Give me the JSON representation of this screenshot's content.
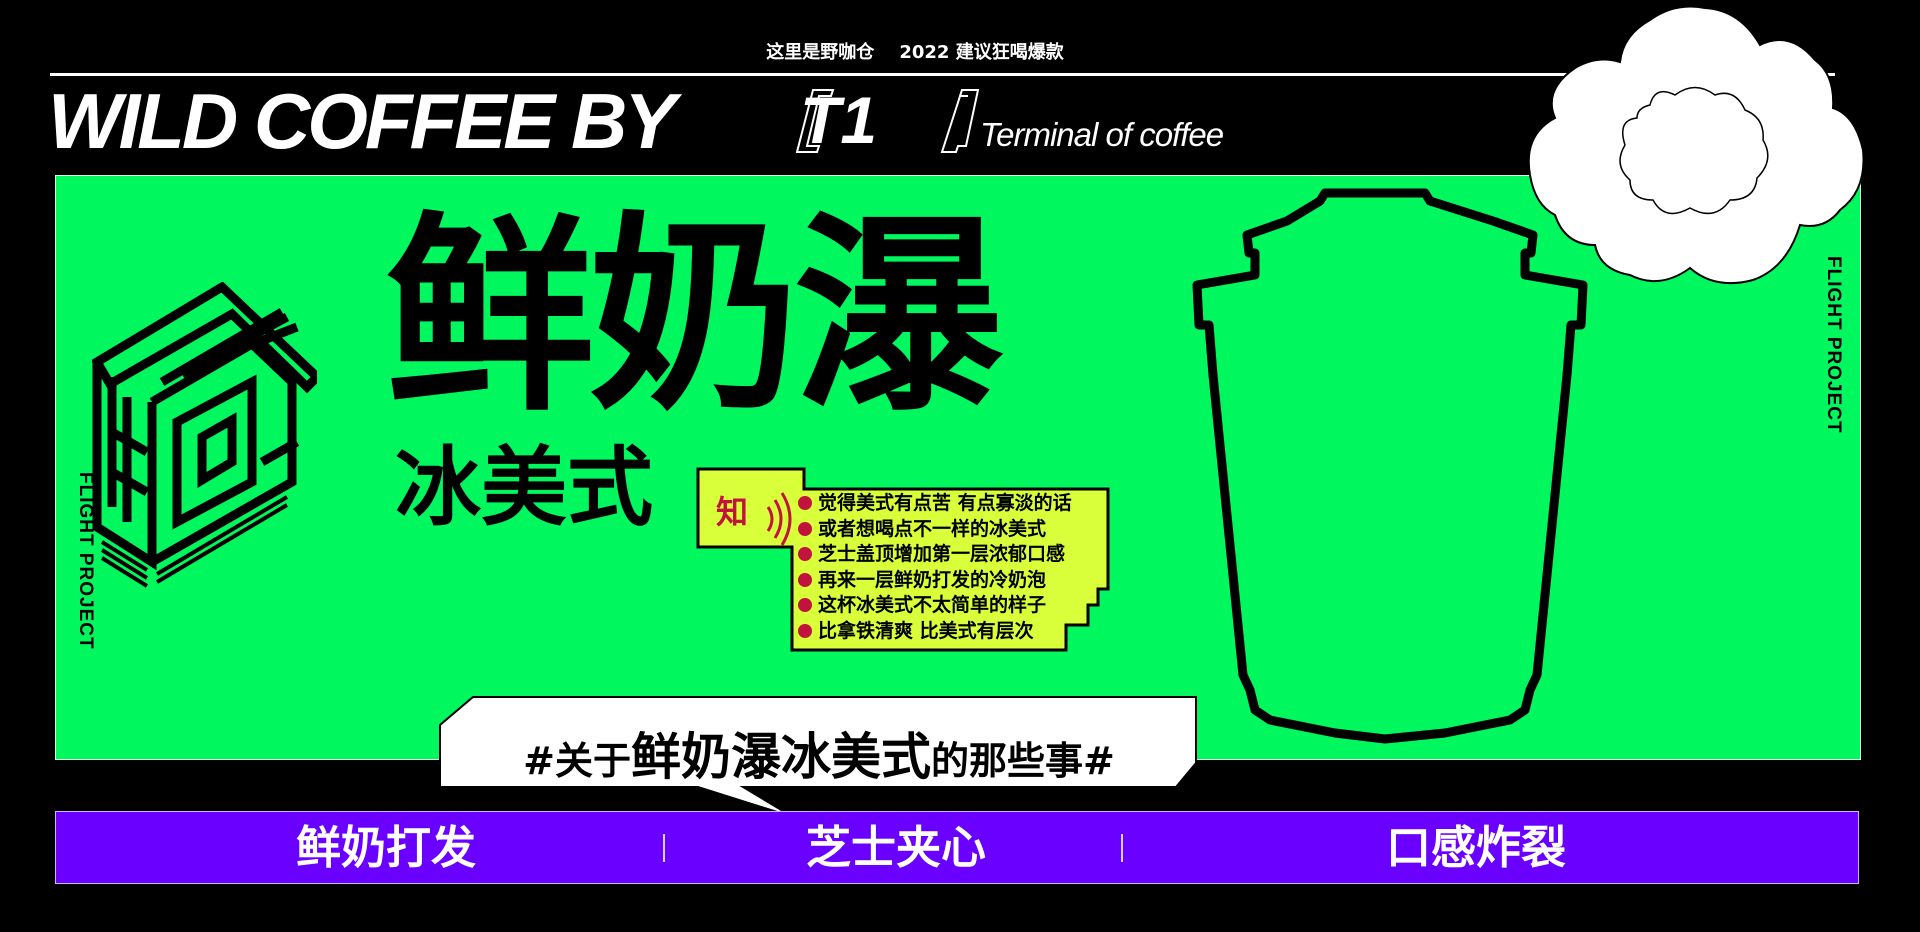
{
  "header": {
    "tagline": "这里是野咖仓    2022 建议狂喝爆款",
    "brand": "WILD COFFEE BY",
    "brand_code": "T1",
    "brand_sub": "Terminal of coffee"
  },
  "side_label": "FLIGHT PROJECT",
  "logo_text": "野咖仓",
  "product": {
    "name": "鲜奶瀑",
    "type": "冰美式"
  },
  "infobox": {
    "icon_text": "知",
    "items": [
      "觉得美式有点苦 有点寡淡的话",
      "或者想喝点不一样的冰美式",
      "芝士盖顶增加第一层浓郁口感",
      "再来一层鲜奶打发的冷奶泡",
      "这杯冰美式不太简单的样子",
      "比拿铁清爽 比美式有层次"
    ]
  },
  "bubble": {
    "prefix": "#关于",
    "highlight": "鲜奶瀑冰美式",
    "suffix": "的那些事#"
  },
  "features": [
    "鲜奶打发",
    "芝士夹心",
    "口感炸裂"
  ],
  "colors": {
    "background": "#000000",
    "panel_green": "#00f85e",
    "bar_purple": "#6a00ff",
    "info_yellow": "#d8ff3a",
    "dot_red": "#c0143c"
  },
  "icons": [
    "cup-outline-icon",
    "cloud-icon",
    "warehouse-logo-icon",
    "sound-wave-icon"
  ]
}
